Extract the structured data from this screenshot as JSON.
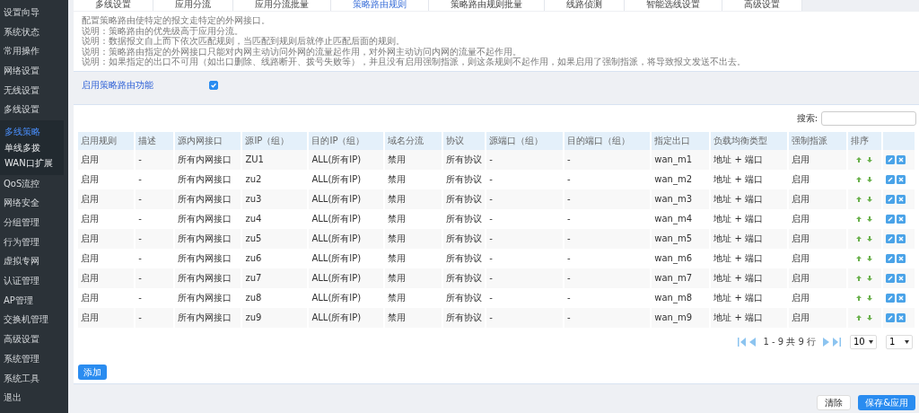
{
  "sidebar": {
    "items": [
      {
        "label": "设置向导",
        "selected": false
      },
      {
        "label": "系统状态",
        "selected": false
      },
      {
        "label": "常用操作",
        "selected": false
      },
      {
        "label": "网络设置",
        "selected": false
      },
      {
        "label": "无线设置",
        "selected": false
      },
      {
        "label": "多线设置",
        "selected": false,
        "expanded": true,
        "children": [
          {
            "label": "多线策略",
            "selected": true
          },
          {
            "label": "单线多拨",
            "selected": false
          },
          {
            "label": "WAN口扩展",
            "selected": false
          }
        ]
      },
      {
        "label": "QoS流控",
        "selected": false
      },
      {
        "label": "网络安全",
        "selected": false
      },
      {
        "label": "分组管理",
        "selected": false
      },
      {
        "label": "行为管理",
        "selected": false
      },
      {
        "label": "虚拟专网",
        "selected": false
      },
      {
        "label": "认证管理",
        "selected": false
      },
      {
        "label": "AP管理",
        "selected": false
      },
      {
        "label": "交换机管理",
        "selected": false
      },
      {
        "label": "高级设置",
        "selected": false
      },
      {
        "label": "系统管理",
        "selected": false
      },
      {
        "label": "系统工具",
        "selected": false
      },
      {
        "label": "退出",
        "selected": false
      }
    ]
  },
  "tabs": [
    {
      "label": "多线设置",
      "selected": false
    },
    {
      "label": "应用分流",
      "selected": false
    },
    {
      "label": "应用分流批量",
      "selected": false
    },
    {
      "label": "策略路由规则",
      "selected": true
    },
    {
      "label": "策略路由规则批量",
      "selected": false
    },
    {
      "label": "线路侦测",
      "selected": false
    },
    {
      "label": "智能选线设置",
      "selected": false
    },
    {
      "label": "高级设置",
      "selected": false
    }
  ],
  "description": [
    "配置策略路由使特定的报文走特定的外网接口。",
    "说明：策略路由的优先级高于应用分流。",
    "说明：数据报文自上而下依次匹配规则，当匹配到规则后就停止匹配后面的规则。",
    "说明：策略路由指定的外网接口只能对内网主动访问外网的流量起作用，对外网主动访问内网的流量不起作用。",
    "说明：如果指定的出口不可用（如出口删除、线路断开、拨号失败等），并且没有启用强制指派，则这条规则不起作用，如果启用了强制指派，将导致报文发送不出去。"
  ],
  "enable_policy": {
    "label": "启用策略路由功能",
    "checked": true
  },
  "search": {
    "label": "搜索:"
  },
  "table": {
    "columns": [
      "启用规则",
      "描述",
      "源内网接口",
      "源IP（组）",
      "目的IP（组）",
      "域名分流",
      "协议",
      "源端口（组）",
      "目的端口（组）",
      "指定出口",
      "负载均衡类型",
      "强制指派",
      "排序"
    ],
    "rows": [
      [
        "启用",
        "-",
        "所有内网接口",
        "ZU1",
        "ALL(所有IP)",
        "禁用",
        "所有协议",
        "-",
        "-",
        "wan_m1",
        "地址 + 端口",
        "启用"
      ],
      [
        "启用",
        "-",
        "所有内网接口",
        "zu2",
        "ALL(所有IP)",
        "禁用",
        "所有协议",
        "-",
        "-",
        "wan_m2",
        "地址 + 端口",
        "启用"
      ],
      [
        "启用",
        "-",
        "所有内网接口",
        "zu3",
        "ALL(所有IP)",
        "禁用",
        "所有协议",
        "-",
        "-",
        "wan_m3",
        "地址 + 端口",
        "启用"
      ],
      [
        "启用",
        "-",
        "所有内网接口",
        "zu4",
        "ALL(所有IP)",
        "禁用",
        "所有协议",
        "-",
        "-",
        "wan_m4",
        "地址 + 端口",
        "启用"
      ],
      [
        "启用",
        "-",
        "所有内网接口",
        "zu5",
        "ALL(所有IP)",
        "禁用",
        "所有协议",
        "-",
        "-",
        "wan_m5",
        "地址 + 端口",
        "启用"
      ],
      [
        "启用",
        "-",
        "所有内网接口",
        "zu6",
        "ALL(所有IP)",
        "禁用",
        "所有协议",
        "-",
        "-",
        "wan_m6",
        "地址 + 端口",
        "启用"
      ],
      [
        "启用",
        "-",
        "所有内网接口",
        "zu7",
        "ALL(所有IP)",
        "禁用",
        "所有协议",
        "-",
        "-",
        "wan_m7",
        "地址 + 端口",
        "启用"
      ],
      [
        "启用",
        "-",
        "所有内网接口",
        "zu8",
        "ALL(所有IP)",
        "禁用",
        "所有协议",
        "-",
        "-",
        "wan_m8",
        "地址 + 端口",
        "启用"
      ],
      [
        "启用",
        "-",
        "所有内网接口",
        "zu9",
        "ALL(所有IP)",
        "禁用",
        "所有协议",
        "-",
        "-",
        "wan_m9",
        "地址 + 端口",
        "启用"
      ]
    ]
  },
  "pagination": {
    "range": "1 - 9 共 9 行",
    "page_size": "10",
    "page": "1"
  },
  "add_button": "添加",
  "footer_buttons": [
    {
      "label": "清除",
      "kind": "secondary"
    },
    {
      "label": "保存&应用",
      "kind": "primary"
    }
  ]
}
